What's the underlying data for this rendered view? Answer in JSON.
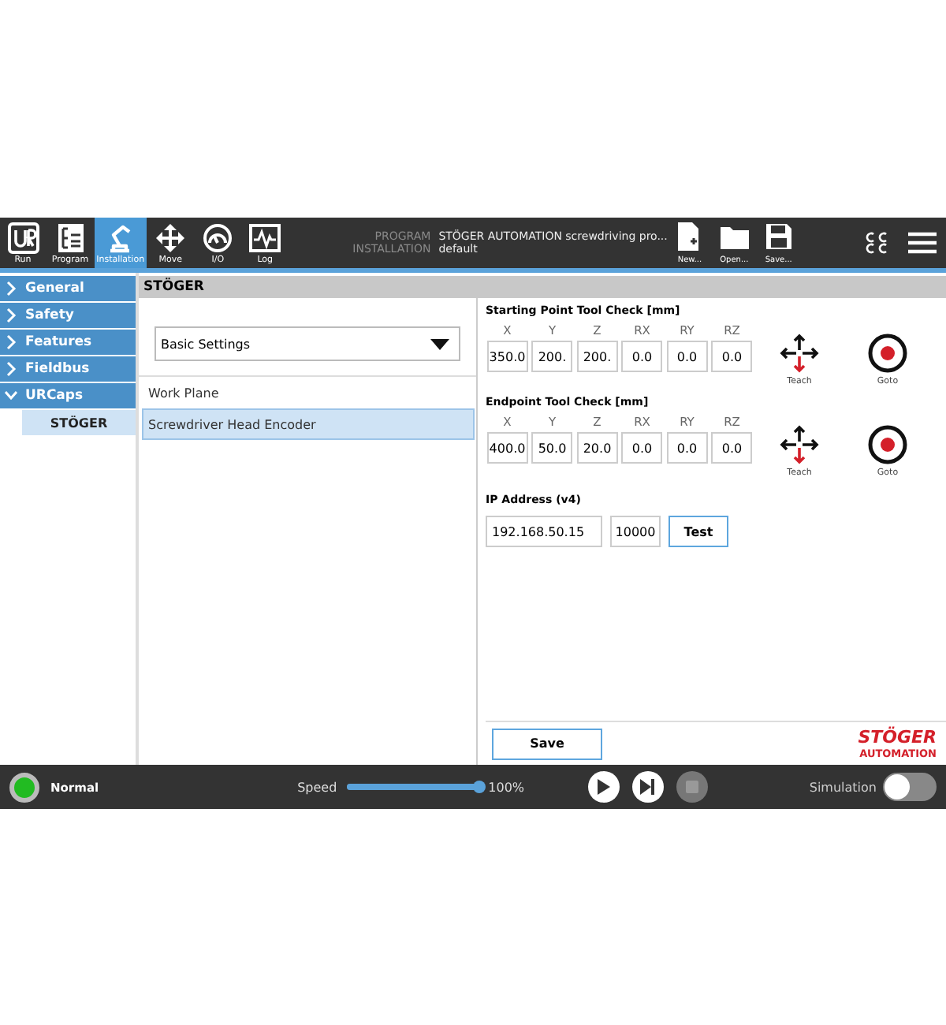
{
  "header": {
    "tabs": [
      {
        "label": "Run",
        "kind": "run",
        "selected": false
      },
      {
        "label": "Program",
        "kind": "program",
        "selected": false
      },
      {
        "label": "Installation",
        "kind": "installation",
        "selected": true
      },
      {
        "label": "Move",
        "kind": "move",
        "selected": false
      },
      {
        "label": "I/O",
        "kind": "io",
        "selected": false
      },
      {
        "label": "Log",
        "kind": "log",
        "selected": false
      }
    ],
    "program_label": "PROGRAM",
    "program_name": "STÖGER AUTOMATION screwdriving pro...",
    "installation_label": "INSTALLATION",
    "installation_name": "default",
    "file_buttons": [
      {
        "label": "New...",
        "kind": "new"
      },
      {
        "label": "Open...",
        "kind": "open"
      },
      {
        "label": "Save...",
        "kind": "save"
      }
    ]
  },
  "sidebar": {
    "items": [
      {
        "label": "General",
        "expanded": false
      },
      {
        "label": "Safety",
        "expanded": false
      },
      {
        "label": "Features",
        "expanded": false
      },
      {
        "label": "Fieldbus",
        "expanded": false
      },
      {
        "label": "URCaps",
        "expanded": true,
        "children": [
          {
            "label": "STÖGER",
            "selected": true
          }
        ]
      }
    ]
  },
  "panel": {
    "title": "STÖGER",
    "dropdown": {
      "value": "Basic Settings"
    },
    "list": [
      {
        "label": "Work Plane",
        "selected": false
      },
      {
        "label": "Screwdriver Head Encoder",
        "selected": true
      }
    ],
    "sections": [
      {
        "title": "Starting Point Tool Check [mm]",
        "axes": [
          {
            "label": "X",
            "value": "350.0"
          },
          {
            "label": "Y",
            "value": "200."
          },
          {
            "label": "Z",
            "value": "200."
          },
          {
            "label": "RX",
            "value": "0.0"
          },
          {
            "label": "RY",
            "value": "0.0"
          },
          {
            "label": "RZ",
            "value": "0.0"
          }
        ],
        "teach_label": "Teach",
        "goto_label": "Goto"
      },
      {
        "title": "Endpoint Tool Check [mm]",
        "axes": [
          {
            "label": "X",
            "value": "400.0"
          },
          {
            "label": "Y",
            "value": "50.0"
          },
          {
            "label": "Z",
            "value": "20.0"
          },
          {
            "label": "RX",
            "value": "0.0"
          },
          {
            "label": "RY",
            "value": "0.0"
          },
          {
            "label": "RZ",
            "value": "0.0"
          }
        ],
        "teach_label": "Teach",
        "goto_label": "Goto"
      }
    ],
    "ip": {
      "title": "IP Address (v4)",
      "address": "192.168.50.15",
      "port": "10000",
      "test_button": "Test"
    },
    "save_button": "Save",
    "logo": {
      "name": "STÖGER",
      "tagline": "AUTOMATION"
    }
  },
  "footer": {
    "status": {
      "label": "Normal",
      "color": "#22bb22"
    },
    "speed_label": "Speed",
    "speed": {
      "level": 1.0
    },
    "speed_reading": "100%",
    "controls": [
      {
        "kind": "play",
        "disabled": false
      },
      {
        "kind": "step",
        "disabled": false
      },
      {
        "kind": "stop",
        "disabled": true
      }
    ],
    "simulation_label": "Simulation",
    "simulation": {
      "on": false
    }
  }
}
